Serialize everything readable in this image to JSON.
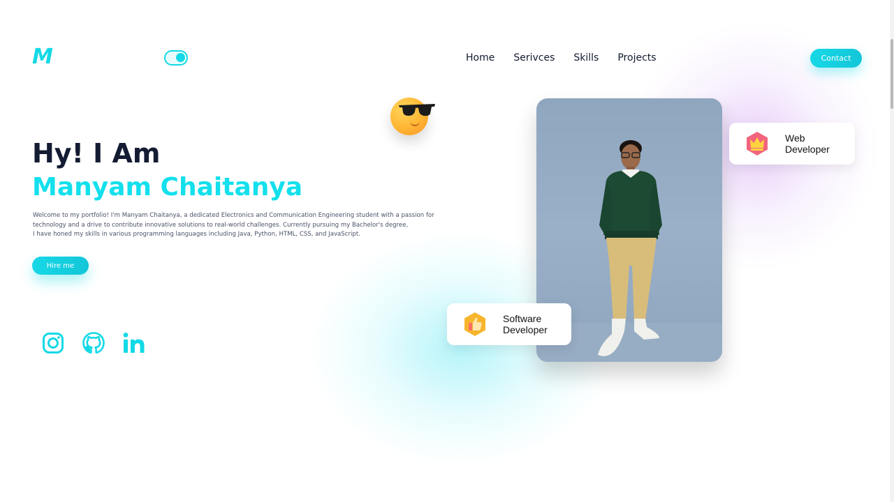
{
  "brand": {
    "logo": "M"
  },
  "theme_toggle": {
    "state": "on"
  },
  "nav": {
    "items": [
      "Home",
      "Serivces",
      "Skills",
      "Projects"
    ],
    "contact_label": "Contact"
  },
  "hero": {
    "greeting": "Hy! I Am",
    "name": "Manyam Chaitanya",
    "intro_lines": [
      "Welcome to my portfolio! I'm Manyam Chaitanya, a dedicated Electronics and Communication Engineering student with a passion for",
      "technology and a drive to contribute innovative solutions to real-world challenges. Currently pursuing my Bachelor's degree,",
      "I have honed my skills in various programming languages including Java, Python, HTML, CSS, and JavaScript."
    ],
    "hire_label": "Hire me"
  },
  "social": [
    {
      "icon": "instagram-icon"
    },
    {
      "icon": "github-icon"
    },
    {
      "icon": "linkedin-icon"
    }
  ],
  "badges": {
    "web": {
      "line1": "Web",
      "line2": "Developer",
      "icon": "crown-icon"
    },
    "software": {
      "line1": "Software",
      "line2": "Developer",
      "icon": "thumbs-up-icon"
    }
  },
  "colors": {
    "accent": "#13d9e6",
    "heading": "#141c33",
    "body_text": "#4a5168",
    "web_badge_icon": "#f2647e",
    "software_badge_icon": "#f6b52c"
  }
}
